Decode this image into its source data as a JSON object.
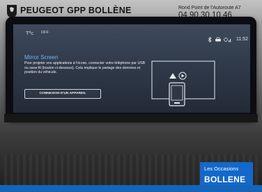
{
  "dealer": {
    "name": "PEUGEOT GPP BOLLÈNE",
    "address": "Rond Point de l'Autoroute A7",
    "phone": "04 90 30 10 46"
  },
  "screen": {
    "status": {
      "temperature": "Tºc",
      "ac_label": "OFF",
      "clock": "11:52",
      "icons": [
        "bluetooth-icon",
        "car-icon",
        "signal-icon"
      ]
    },
    "mirror": {
      "title": "Mirror Screen",
      "description": "Pour projeter vos applications à l'écran, connecter votre téléphone par USB ou sans-fil (bouton ci-dessous). Cela implique le partage des données et position du véhicule.",
      "button_label": "CONNEXION D'UN APPAREIL"
    }
  },
  "badge": {
    "line1": "Les Occasions",
    "line2": "BOLLENE"
  },
  "colors": {
    "accent": "#6fb7ff",
    "badge_blue": "#1468c9"
  }
}
